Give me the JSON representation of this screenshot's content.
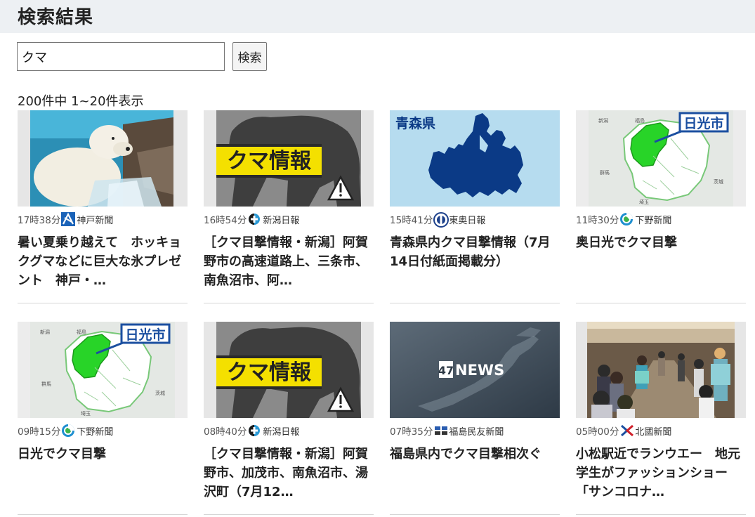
{
  "header": {
    "title": "検索結果"
  },
  "search": {
    "value": "クマ",
    "button_label": "検索"
  },
  "results_count": "200件中 1~20件表示",
  "colors": {
    "header_bg": "#edf0f3",
    "badge_yellow": "#f4e000",
    "map_green": "#28d428"
  },
  "cards": [
    {
      "time": "17時38分",
      "source": "神戸新聞",
      "title": "暑い夏乗り越えて　ホッキョクグマなどに巨大な氷プレゼント　神戸・…",
      "thumb_icon": "polar-bear-photo"
    },
    {
      "time": "16時54分",
      "source": "新潟日報",
      "title": "［クマ目撃情報・新潟］阿賀野市の高速道路上、三条市、南魚沼市、阿…",
      "thumb_icon": "bear-silhouette-warning",
      "badge": "クマ情報"
    },
    {
      "time": "15時41分",
      "source": "東奥日報",
      "title": "青森県内クマ目撃情報（7月14日付紙面掲載分）",
      "thumb_icon": "aomori-map",
      "badge": "青森県"
    },
    {
      "time": "11時30分",
      "source": "下野新聞",
      "title": "奥日光でクマ目撃",
      "thumb_icon": "tochigi-map",
      "badge": "日光市",
      "map_labels": [
        "新潟",
        "福島",
        "群馬",
        "茨城",
        "埼玉"
      ]
    },
    {
      "time": "09時15分",
      "source": "下野新聞",
      "title": "日光でクマ目撃",
      "thumb_icon": "tochigi-map",
      "badge": "日光市",
      "map_labels": [
        "新潟",
        "福島",
        "群馬",
        "茨城",
        "埼玉"
      ]
    },
    {
      "time": "08時40分",
      "source": "新潟日報",
      "title": "［クマ目撃情報・新潟］阿賀野市、加茂市、南魚沼市、湯沢町（7月12…",
      "thumb_icon": "bear-silhouette-warning",
      "badge": "クマ情報"
    },
    {
      "time": "07時35分",
      "source": "福島民友新聞",
      "title": "福島県内でクマ目撃相次ぐ",
      "thumb_icon": "47news-map",
      "badge_num": "47",
      "badge_text": "NEWS"
    },
    {
      "time": "05時00分",
      "source": "北國新聞",
      "title": "小松駅近でランウエー　地元学生がファッションショー　「サンコロナ…",
      "thumb_icon": "fashion-show-photo"
    }
  ]
}
